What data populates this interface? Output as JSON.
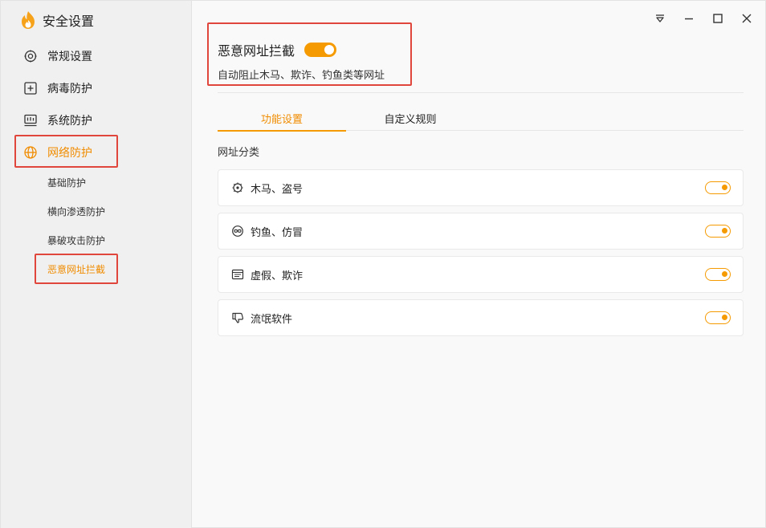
{
  "app": {
    "title": "安全设置"
  },
  "sidebar": {
    "items": [
      {
        "label": "常规设置",
        "icon": "gear-icon"
      },
      {
        "label": "病毒防护",
        "icon": "plus-square-icon"
      },
      {
        "label": "系统防护",
        "icon": "system-monitor-icon"
      },
      {
        "label": "网络防护",
        "icon": "globe-icon",
        "active": true
      }
    ],
    "subitems": [
      {
        "label": "基础防护"
      },
      {
        "label": "横向渗透防护"
      },
      {
        "label": "暴破攻击防护"
      },
      {
        "label": "恶意网址拦截",
        "active": true
      }
    ]
  },
  "window_controls": [
    "menu-icon",
    "minimize-icon",
    "maximize-icon",
    "close-icon"
  ],
  "main": {
    "title": "恶意网址拦截",
    "toggle_on": true,
    "description": "自动阻止木马、欺诈、钓鱼类等网址",
    "tabs": [
      {
        "label": "功能设置",
        "active": true
      },
      {
        "label": "自定义规则"
      }
    ],
    "section_label": "网址分类",
    "categories": [
      {
        "label": "木马、盗号",
        "icon": "trojan-icon",
        "enabled": true
      },
      {
        "label": "钓鱼、仿冒",
        "icon": "mask-icon",
        "enabled": true
      },
      {
        "label": "虚假、欺诈",
        "icon": "document-icon",
        "enabled": true
      },
      {
        "label": "流氓软件",
        "icon": "thumbs-down-icon",
        "enabled": true
      }
    ]
  },
  "colors": {
    "accent": "#f59a00",
    "highlight": "#e0463c"
  }
}
